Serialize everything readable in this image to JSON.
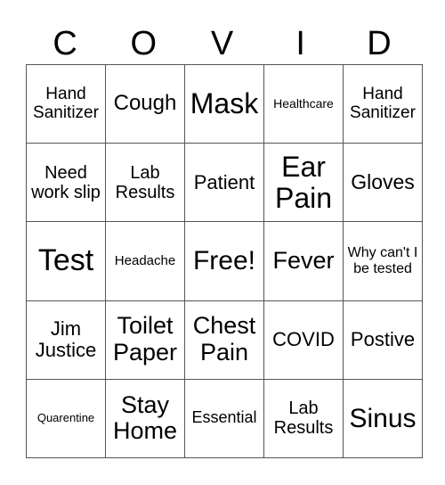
{
  "title_letters": [
    "C",
    "O",
    "V",
    "I",
    "D"
  ],
  "rows": [
    [
      "Hand Sanitizer",
      "Cough",
      "Mask",
      "Healthcare",
      "Hand Sanitizer"
    ],
    [
      "Need work slip",
      "Lab Results",
      "Patient",
      "Ear Pain",
      "Gloves"
    ],
    [
      "Test",
      "Headache",
      "Free!",
      "Fever",
      "Why can't I be tested"
    ],
    [
      "Jim Justice",
      "Toilet Paper",
      "Chest Pain",
      "COVID",
      "Postive"
    ],
    [
      "Quarentine",
      "Stay Home",
      "Essential",
      "Lab Results",
      "Sinus"
    ]
  ]
}
